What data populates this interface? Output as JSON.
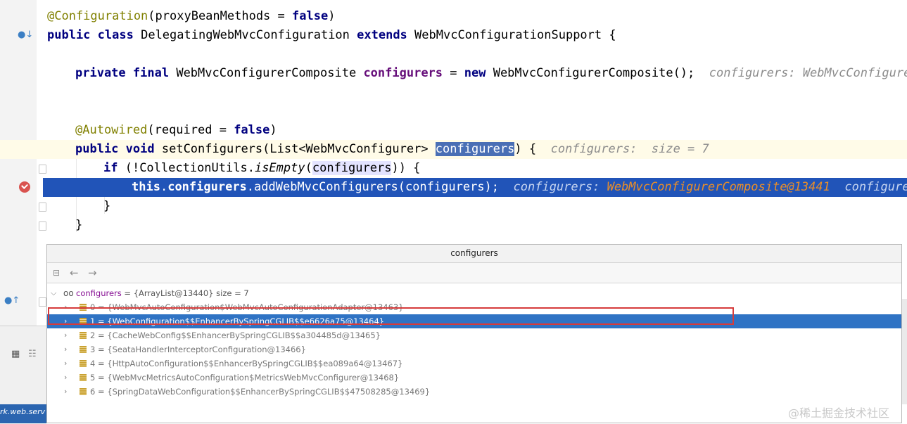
{
  "code": {
    "line_config": {
      "ann": "@Configuration",
      "args": "(proxyBeanMethods = ",
      "kw_false": "false",
      "close": ")"
    },
    "line_class": {
      "kw_public": "public",
      "kw_class": "class",
      "name": " DelegatingWebMvcConfiguration ",
      "kw_extends": "extends",
      "rest": " WebMvcConfigurationSupport {"
    },
    "line_field": {
      "kw_private": "private",
      "kw_final": "final",
      "type": " WebMvcConfigurerComposite ",
      "field": "configurers",
      "eq": " = ",
      "kw_new": "new",
      "rest": " WebMvcConfigurerComposite();",
      "hint": "configurers: WebMvcConfigurerCo"
    },
    "line_autowired": {
      "ann": "@Autowired",
      "args": "(required = ",
      "kw_false": "false",
      "close": ")"
    },
    "line_setter": {
      "kw_public": "public",
      "kw_void": "void",
      "name": " setConfigurers(List<WebMvcConfigurer> ",
      "param": "configurers",
      "rest": ") {",
      "hint": "configurers:  size = 7"
    },
    "line_if": {
      "kw_if": "if",
      "pre": " (!CollectionUtils.",
      "method": "isEmpty",
      "open": "(",
      "param": "configurers",
      "rest": ")) {"
    },
    "line_exec": {
      "kw_this": "this",
      "dot": ".",
      "field": "configurers",
      "rest": ".addWebMvcConfigurers(configurers);",
      "hint_label": "configurers:",
      "hint_value": "WebMvcConfigurerComposite@13441",
      "hint_tail": "configurers"
    },
    "close_inner": "}",
    "close_outer": "}"
  },
  "popup": {
    "title": "configurers",
    "root": {
      "name": "configurers",
      "value": " = {ArrayList@13440}  size = 7"
    },
    "items": [
      {
        "text": "0 = {WebMvcAutoConfiguration$WebMvcAutoConfigurationAdapter@13463}"
      },
      {
        "text": "1 = {WebConfiguration$$EnhancerBySpringCGLIB$$e6626a75@13464}"
      },
      {
        "text": "2 = {CacheWebConfig$$EnhancerBySpringCGLIB$$a304485d@13465}"
      },
      {
        "text": "3 = {SeataHandlerInterceptorConfiguration@13466}"
      },
      {
        "text": "4 = {HttpAutoConfiguration$$EnhancerBySpringCGLIB$$ea089a64@13467}"
      },
      {
        "text": "5 = {WebMvcMetricsAutoConfiguration$MetricsWebMvcConfigurer@13468}"
      },
      {
        "text": "6 = {SpringDataWebConfiguration$$EnhancerBySpringCGLIB$$47508285@13469}"
      }
    ],
    "selected_index": 1
  },
  "status_text": "rk.web.serv",
  "watermark": "@稀土掘金技术社区",
  "colors": {
    "selection": "#2f73c4",
    "highlight_box": "#d63b3b",
    "exec_line": "#2154b8"
  },
  "icons": [
    "breakpoint-icon",
    "override-icon",
    "implement-icon",
    "collapse-icon",
    "back-arrow-icon",
    "forward-arrow-icon",
    "glasses-icon",
    "field-icon",
    "chevron-right-icon",
    "chevron-down-icon"
  ]
}
